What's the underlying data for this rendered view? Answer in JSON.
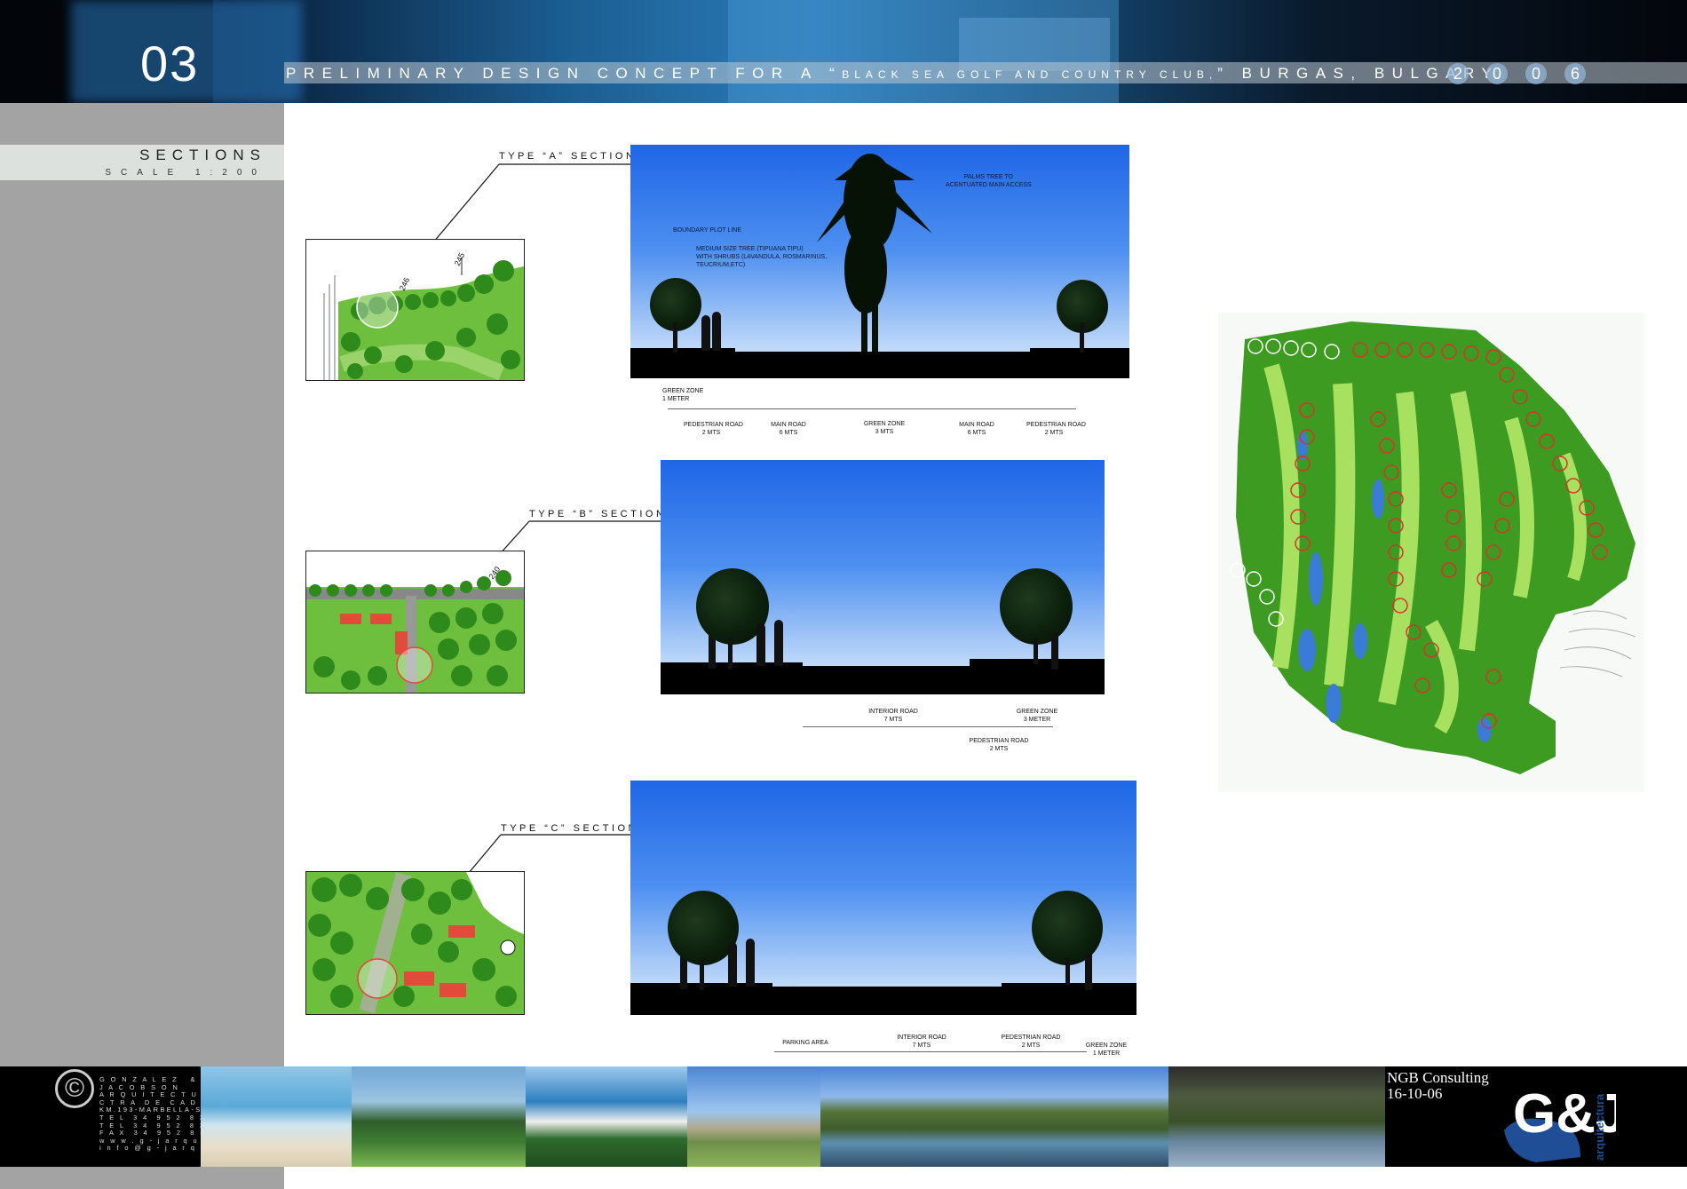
{
  "header": {
    "page_number": "03",
    "title_main": "PRELIMINARY DESIGN CONCEPT FOR A “",
    "title_club": "BLACK SEA GOLF AND COUNTRY CLUB,",
    "title_end": "” BURGAS, BULGARY",
    "year_digits": [
      "2",
      "0",
      "0",
      "6"
    ]
  },
  "sidebar": {
    "title": "SECTIONS",
    "scale": "SCALE 1:200"
  },
  "section_a": {
    "label": "TYPE “A” SECTION",
    "plan_marks": [
      "246",
      "245"
    ],
    "notes": {
      "palms": "PALMS TREE TO\nACENTUATED MAIN ACCESS",
      "boundary": "BOUNDARY PLOT LINE",
      "medium_tree": "MEDIUM SIZE TREE (TIPUANA TIPU)\nWITH SHRUBS (LAVANDULA, ROSMARINUS,\nTEUCRIUM,ETC)"
    },
    "dims": [
      {
        "name": "GREEN ZONE",
        "size": "1 METER"
      },
      {
        "name": "PEDESTRIAN ROAD",
        "size": "2 MTS"
      },
      {
        "name": "MAIN ROAD",
        "size": "6 MTS"
      },
      {
        "name": "GREEN ZONE",
        "size": "3 MTS"
      },
      {
        "name": "MAIN ROAD",
        "size": "6 MTS"
      },
      {
        "name": "PEDESTRIAN ROAD",
        "size": "2 MTS"
      }
    ]
  },
  "section_b": {
    "label": "TYPE “B” SECTION",
    "plan_marks": [
      "240"
    ],
    "dims": [
      {
        "name": "INTERIOR ROAD",
        "size": "7 MTS"
      },
      {
        "name": "GREEN ZONE",
        "size": "3 METER"
      },
      {
        "name": "PEDESTRIAN ROAD",
        "size": "2 MTS"
      }
    ]
  },
  "section_c": {
    "label": "TYPE “C” SECTION",
    "dims": [
      {
        "name": "PARKING AREA",
        "size": ""
      },
      {
        "name": "INTERIOR ROAD",
        "size": "7 MTS"
      },
      {
        "name": "PEDESTRIAN ROAD",
        "size": "2 MTS"
      },
      {
        "name": "GREEN ZONE",
        "size": "1 METER"
      }
    ]
  },
  "footer": {
    "copyright_symbol": "©",
    "company_lines": "G O N Z A L E Z   &\nJ A C O B S O N\nA R Q U I T E C T U R A\nC T R A  D E  C A D I Z\nKM.193-MARBELLA-SPAIN-\nT E L  3 4  9 5 2  8 3  2 8 5 9\nT E L  3 4  9 5 2  8 3  4 9 5 3\nF A X  3 4  9 5 2  8 3  6 7 9 4\nw w w . g - j a r q u i t e c t u r a . c o m\ni n f o @ g - j a r q u i t e c t u r a . c o m",
    "consultant": "NGB Consulting",
    "date": "16-10-06",
    "logo_text": "G&J",
    "logo_sub": "arquitectura"
  },
  "colors": {
    "sky_top": "#1f66e6",
    "sky_bottom": "#dfeefd",
    "sidebar_gray": "#a3a3a3",
    "vegetation_green": "#4caf2c"
  }
}
